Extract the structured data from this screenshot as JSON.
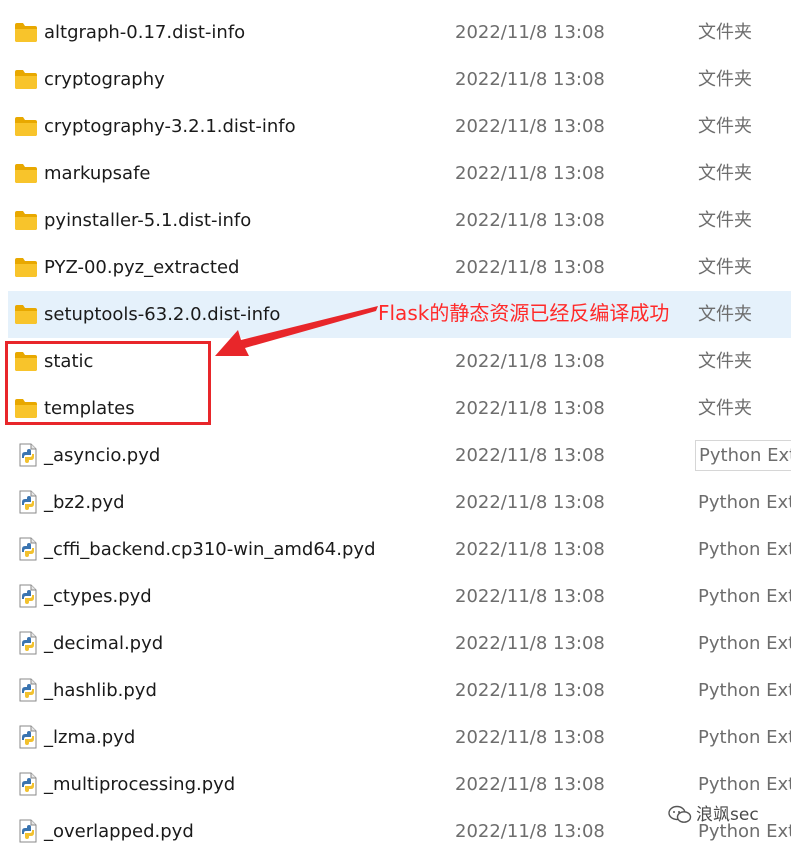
{
  "files": [
    {
      "name": "altgraph-0.17.dist-info",
      "date": "2022/11/8 13:08",
      "type": "文件夹",
      "icon": "folder-icon",
      "selected": false
    },
    {
      "name": "cryptography",
      "date": "2022/11/8 13:08",
      "type": "文件夹",
      "icon": "folder-icon",
      "selected": false
    },
    {
      "name": "cryptography-3.2.1.dist-info",
      "date": "2022/11/8 13:08",
      "type": "文件夹",
      "icon": "folder-icon",
      "selected": false
    },
    {
      "name": "markupsafe",
      "date": "2022/11/8 13:08",
      "type": "文件夹",
      "icon": "folder-icon",
      "selected": false
    },
    {
      "name": "pyinstaller-5.1.dist-info",
      "date": "2022/11/8 13:08",
      "type": "文件夹",
      "icon": "folder-icon",
      "selected": false
    },
    {
      "name": "PYZ-00.pyz_extracted",
      "date": "2022/11/8 13:08",
      "type": "文件夹",
      "icon": "folder-icon",
      "selected": false
    },
    {
      "name": "setuptools-63.2.0.dist-info",
      "date": "",
      "type": "文件夹",
      "icon": "folder-icon",
      "selected": true
    },
    {
      "name": "static",
      "date": "2022/11/8 13:08",
      "type": "文件夹",
      "icon": "folder-icon",
      "selected": false
    },
    {
      "name": "templates",
      "date": "2022/11/8 13:08",
      "type": "文件夹",
      "icon": "folder-icon",
      "selected": false
    },
    {
      "name": "_asyncio.pyd",
      "date": "2022/11/8 13:08",
      "type": "Python Ext",
      "icon": "python-file-icon",
      "selected": false,
      "boxed": true
    },
    {
      "name": "_bz2.pyd",
      "date": "2022/11/8 13:08",
      "type": "Python Ext",
      "icon": "python-file-icon",
      "selected": false
    },
    {
      "name": "_cffi_backend.cp310-win_amd64.pyd",
      "date": "2022/11/8 13:08",
      "type": "Python Ext",
      "icon": "python-file-icon",
      "selected": false
    },
    {
      "name": "_ctypes.pyd",
      "date": "2022/11/8 13:08",
      "type": "Python Ext",
      "icon": "python-file-icon",
      "selected": false
    },
    {
      "name": "_decimal.pyd",
      "date": "2022/11/8 13:08",
      "type": "Python Ext",
      "icon": "python-file-icon",
      "selected": false
    },
    {
      "name": "_hashlib.pyd",
      "date": "2022/11/8 13:08",
      "type": "Python Ext",
      "icon": "python-file-icon",
      "selected": false
    },
    {
      "name": "_lzma.pyd",
      "date": "2022/11/8 13:08",
      "type": "Python Ext",
      "icon": "python-file-icon",
      "selected": false
    },
    {
      "name": "_multiprocessing.pyd",
      "date": "2022/11/8 13:08",
      "type": "Python Ext",
      "icon": "python-file-icon",
      "selected": false
    },
    {
      "name": "_overlapped.pyd",
      "date": "2022/11/8 13:08",
      "type": "Python Ext",
      "icon": "python-file-icon",
      "selected": false
    }
  ],
  "annotation": {
    "text": "Flask的静态资源已经反编译成功",
    "color": "#ff2a2a"
  },
  "watermark": {
    "text": "浪飒sec",
    "icon": "wechat-icon"
  },
  "colors": {
    "folder": "#f8c42b",
    "selected_row": "#e5f1fb",
    "highlight_box": "#e8262a"
  }
}
